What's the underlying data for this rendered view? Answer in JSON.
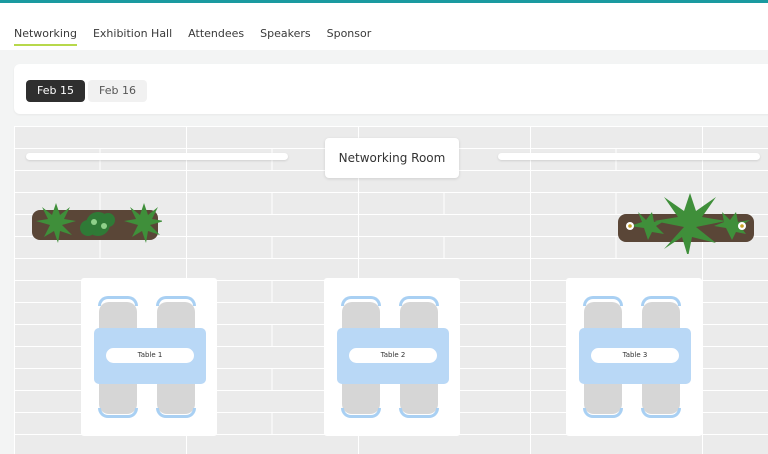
{
  "tabs": [
    {
      "label": "Networking",
      "active": true
    },
    {
      "label": "Exhibition Hall"
    },
    {
      "label": "Attendees"
    },
    {
      "label": "Speakers"
    },
    {
      "label": "Sponsor"
    }
  ],
  "dates": [
    {
      "label": "Feb 15",
      "active": true
    },
    {
      "label": "Feb 16"
    }
  ],
  "room": {
    "title": "Networking Room",
    "tables": [
      {
        "label": "Table 1"
      },
      {
        "label": "Table 2"
      },
      {
        "label": "Table 3"
      }
    ]
  },
  "colors": {
    "accent_bar": "#1a9aa0",
    "active_tab_underline": "#b7d84b",
    "table_blue": "#b9d8f6",
    "chair_arc": "#a9d0f3"
  }
}
